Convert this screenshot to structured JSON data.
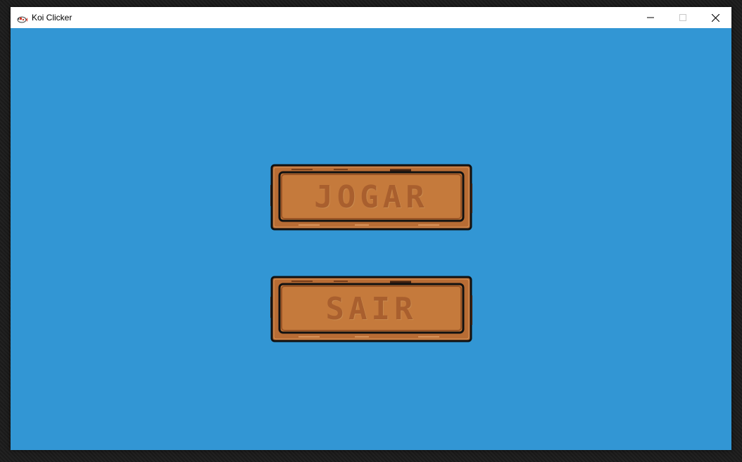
{
  "window": {
    "title": "Koi Clicker",
    "icon": "koi-fish-icon"
  },
  "controls": {
    "minimize": "minimize-icon",
    "maximize": "maximize-icon",
    "close": "close-icon"
  },
  "menu": {
    "play_label": "JOGAR",
    "quit_label": "SAIR"
  },
  "colors": {
    "background": "#3296d4",
    "plank_fill": "#c57a3c",
    "plank_border": "#111111",
    "label": "#a95f2e"
  }
}
